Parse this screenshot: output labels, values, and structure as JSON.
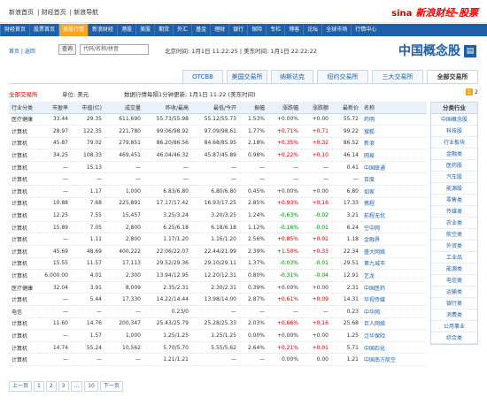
{
  "topbar": {
    "links": [
      "新浪首页",
      "财经首页",
      "新浪导航"
    ],
    "logo_text": "sina",
    "brand": "新浪财经-股票"
  },
  "nav": {
    "items": [
      "财经首页",
      "股票首页",
      "美股行情",
      "新浪财经",
      "港股",
      "美股",
      "期货",
      "外汇",
      "基金",
      "理财",
      "银行",
      "保险",
      "专栏",
      "博客",
      "论坛",
      "全球市场",
      "行情中心"
    ],
    "active_index": 2
  },
  "search": {
    "links": "首页 | 返回",
    "button": "查询",
    "placeholder": "代码/名称/拼音",
    "time": "北京时间: 1月1日 11:22:25 | 美东时间: 1月1日 22:22:22"
  },
  "page_title": "中国概念股",
  "tabs": [
    "全部交易所",
    "三大交易所",
    "纽约交易所",
    "纳斯达克",
    "美国交易所",
    "OTCBB"
  ],
  "info": {
    "red_label": "全部交易所",
    "unit": "单位: 美元",
    "update": "数据行情每隔1分钟更新; 1月1日 11:22 (美东时间)",
    "pages": [
      "1",
      "2"
    ],
    "cur_page": "1"
  },
  "table": {
    "headers": [
      "行业分类",
      "市盈率",
      "市值(亿)",
      "成交量",
      "昨收/最高",
      "最低/今开",
      "振幅",
      "涨跌幅",
      "涨跌额",
      "最新价",
      "名称"
    ],
    "rows": [
      [
        "医疗健康",
        "33.44",
        "29.35",
        "611,690",
        "55.73/55.98",
        "55.12/55.73",
        "1.53%",
        "+0.00%",
        "+0.00",
        "55.72",
        "药明"
      ],
      [
        "计算机",
        "28.97",
        "122.35",
        "221,780",
        "99.06/98.92",
        "97.09/98.61",
        "1.77%",
        "+0.71%",
        "+0.71",
        "99.22",
        "搜狐"
      ],
      [
        "计算机",
        "45.87",
        "79.02",
        "279,851",
        "86.20/86.56",
        "84.68/85.95",
        "2.18%",
        "+0.35%",
        "+0.32",
        "86.52",
        "新浪"
      ],
      [
        "计算机",
        "34.25",
        "108.33",
        "469,451",
        "46.04/46.32",
        "45.87/45.89",
        "0.98%",
        "+0.22%",
        "+0.10",
        "46.14",
        "网易"
      ],
      [
        "计算机",
        "—",
        "15.13",
        "—",
        "—",
        "—",
        "—",
        "—",
        "—",
        "0.41",
        "中国联通"
      ],
      [
        "计算机",
        "—",
        "—",
        "—",
        "—",
        "—",
        "—",
        "—",
        "—",
        "—",
        "百度"
      ],
      [
        "计算机",
        "—",
        "1.17",
        "1,000",
        "6.83/6.80",
        "6.80/6.80",
        "0.45%",
        "+0.00%",
        "+0.00",
        "6.80",
        "如家"
      ],
      [
        "计算机",
        "10.88",
        "7.68",
        "225,891",
        "17.17/17.42",
        "16.93/17.25",
        "2.85%",
        "+0.93%",
        "+0.16",
        "17.33",
        "携程"
      ],
      [
        "计算机",
        "12.25",
        "7.55",
        "15,457",
        "3.25/3.24",
        "3.20/3.25",
        "1.24%",
        "-0.63%",
        "-0.02",
        "3.21",
        "前程无忧"
      ],
      [
        "计算机",
        "15.89",
        "7.05",
        "2,800",
        "6.25/6.18",
        "6.18/6.18",
        "1.12%",
        "-0.16%",
        "-0.01",
        "6.24",
        "空中网"
      ],
      [
        "计算机",
        "—",
        "1.11",
        "2,800",
        "1.17/1.20",
        "1.16/1.20",
        "2.56%",
        "+0.85%",
        "+0.01",
        "1.18",
        "金融界"
      ],
      [
        "计算机",
        "45.69",
        "48.69",
        "400,222",
        "22.06/22.07",
        "22.44/21.99",
        "2.39%",
        "+1.50%",
        "+0.33",
        "22.34",
        "盛大网络"
      ],
      [
        "计算机",
        "15.55",
        "11.57",
        "17,113",
        "29.52/29.36",
        "29.10/29.11",
        "1.37%",
        "-0.03%",
        "-0.01",
        "29.51",
        "第九城市"
      ],
      [
        "计算机",
        "6,000.00",
        "4.01",
        "2,300",
        "13.94/12.95",
        "12.20/12.31",
        "0.80%",
        "-0.31%",
        "-0.04",
        "12.91",
        "艺龙"
      ],
      [
        "医疗健康",
        "32.04",
        "3.91",
        "8,009",
        "2.35/2.31",
        "2.30/2.31",
        "0.39%",
        "+0.00%",
        "+0.00",
        "2.31",
        "中国医药"
      ],
      [
        "计算机",
        "—",
        "5.44",
        "17,330",
        "14.22/14.44",
        "13.98/14.00",
        "2.87%",
        "+0.61%",
        "+0.09",
        "14.31",
        "华视传媒"
      ],
      [
        "电信",
        "—",
        "—",
        "—",
        "0.23/0",
        "—",
        "—",
        "—",
        "—",
        "0.23",
        "中华网"
      ],
      [
        "计算机",
        "11.60",
        "14.76",
        "200,347",
        "25.43/25.79",
        "25.28/25.33",
        "2.03%",
        "+0.66%",
        "+0.16",
        "25.68",
        "巨人网络"
      ],
      [
        "计算机",
        "—",
        "1.57",
        "1,000",
        "1.25/1.25",
        "1.25/1.25",
        "0.00%",
        "+0.00%",
        "+0.00",
        "1.25",
        "泛华保险"
      ],
      [
        "计算机",
        "14.74",
        "55.24",
        "10,562",
        "5.70/5.70",
        "5.55/5.62",
        "2.64%",
        "+0.21%",
        "+0.01",
        "5.71",
        "中国石化"
      ],
      [
        "计算机",
        "—",
        "—",
        "—",
        "1.21/1.21",
        "—",
        "—",
        "0.00%",
        "0.00",
        "1.21",
        "中国南方航空"
      ]
    ]
  },
  "sidebar": {
    "head": "分类行业",
    "items": [
      "中国概念股",
      "科技股",
      "行业板块",
      "金融类",
      "医药股",
      "汽车股",
      "能源股",
      "零售类",
      "传媒类",
      "农业类",
      "航空类",
      "外贸类",
      "工业品",
      "能源类",
      "电信类",
      "运输类",
      "银行类",
      "消费类",
      "公用事业",
      "综合类"
    ]
  },
  "pager": [
    "上一页",
    "1",
    "2",
    "3",
    "...",
    "10",
    "下一页"
  ]
}
